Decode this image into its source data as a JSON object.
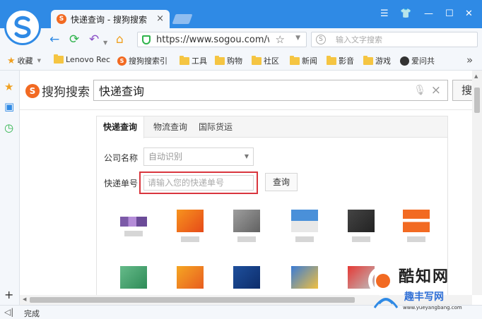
{
  "browser": {
    "tab_title": "快递查询 - 搜狗搜索",
    "tab_favicon": "S",
    "close_glyph": "×",
    "url": "https://www.sogou.com/we",
    "search_placeholder": "输入文字搜索",
    "status": "完成"
  },
  "bookmarks": [
    {
      "label": "收藏",
      "icon": "star-icon"
    },
    {
      "label": "Lenovo Rec",
      "icon": "folder-icon"
    },
    {
      "label": "搜狗搜索引",
      "icon": "sogou-icon"
    },
    {
      "label": "工具",
      "icon": "folder-icon"
    },
    {
      "label": "购物",
      "icon": "folder-icon"
    },
    {
      "label": "社区",
      "icon": "folder-icon"
    },
    {
      "label": "新闻",
      "icon": "folder-icon"
    },
    {
      "label": "影音",
      "icon": "folder-icon"
    },
    {
      "label": "游戏",
      "icon": "folder-icon"
    },
    {
      "label": "爱问共",
      "icon": "user-icon"
    }
  ],
  "sogou": {
    "logo_text": "搜狗搜索",
    "query": "快递查询",
    "search_button": "搜"
  },
  "express": {
    "tabs": [
      "快递查询",
      "物流查询",
      "国际货运"
    ],
    "company_label": "公司名称",
    "company_value": "自动识别",
    "number_label": "快递单号",
    "number_placeholder": "请输入您的快递单号",
    "query_button": "查询"
  },
  "colors": {
    "titlebar": "#2f8ae5",
    "highlight": "#d9363e",
    "sogou_orange": "#f26a22"
  },
  "watermark": {
    "title": "酷知网",
    "subtitle": "趣丰写网",
    "url": "www.yueyangbang.com"
  }
}
